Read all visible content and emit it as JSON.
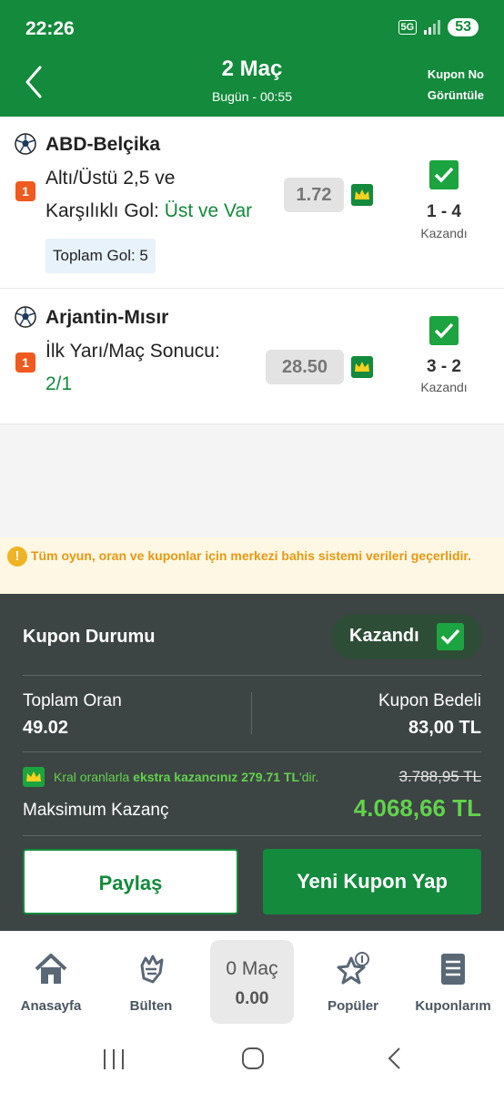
{
  "status_bar": {
    "time": "22:26",
    "network": "5G",
    "battery": "53"
  },
  "header": {
    "title": "2 Maç",
    "subtitle": "Bugün - 00:55",
    "right_line1": "Kupon No",
    "right_line2": "Görüntüle"
  },
  "matches": [
    {
      "teams": "ABD-Belçika",
      "pick_badge": "1",
      "market_line1": "Altı/Üstü 2,5 ve",
      "market_line2": "Karşılıklı Gol: ",
      "selection": "Üst ve Var",
      "odd": "1.72",
      "score": "1 - 4",
      "status": "Kazandı",
      "extra_info": "Toplam Gol: 5"
    },
    {
      "teams": "Arjantin-Mısır",
      "pick_badge": "1",
      "market_line1": "İlk Yarı/Maç Sonucu:",
      "selection": "2/1",
      "odd": "28.50",
      "score": "3 - 2",
      "status": "Kazandı"
    }
  ],
  "warning": {
    "text": "Tüm oyun, oran ve kuponlar için merkezi bahis sistemi verileri geçerlidir."
  },
  "coupon": {
    "status_label": "Kupon Durumu",
    "status_value": "Kazandı",
    "total_odds_label": "Toplam Oran",
    "total_odds_value": "49.02",
    "stake_label": "Kupon Bedeli",
    "stake_value": "83,00 TL",
    "king_prefix": "Kral oranlarla ",
    "king_bold": "ekstra kazancınız 279.71 TL",
    "king_suffix": "'dir.",
    "old_max": "3.788,95 TL",
    "max_win_label": "Maksimum Kazanç",
    "max_win_value": "4.068,66 TL",
    "share_label": "Paylaş",
    "new_coupon_label": "Yeni Kupon Yap"
  },
  "bottom_nav": {
    "items": [
      {
        "label": "Anasayfa",
        "icon": "home-icon"
      },
      {
        "label": "Bülten",
        "icon": "hand-icon"
      },
      {
        "label": "Popüler",
        "icon": "star-icon"
      },
      {
        "label": "Kuponlarım",
        "icon": "document-icon"
      }
    ],
    "slip_count": "0 Maç",
    "slip_total": "0.00"
  },
  "colors": {
    "brand_green": "#138a3c",
    "win_green": "#62d24c",
    "dark_panel": "#3d4444",
    "pick_orange": "#ef5a1f",
    "warning_orange": "#e89813"
  }
}
